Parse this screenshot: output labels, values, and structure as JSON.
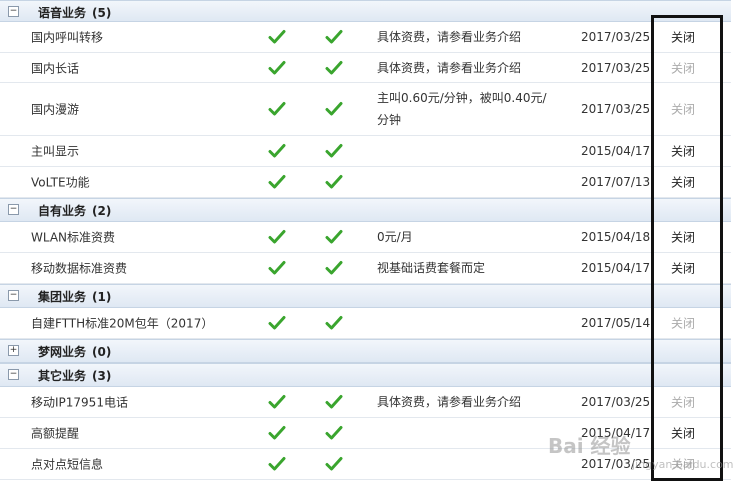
{
  "groups": [
    {
      "title": "语音业务",
      "count": "(5)",
      "toggle": "−",
      "rows": [
        {
          "name": "国内呼叫转移",
          "desc": "具体资费，请参看业务介绍",
          "date": "2017/03/25",
          "action": "关闭",
          "action_enabled": true
        },
        {
          "name": "国内长话",
          "desc": "具体资费，请参看业务介绍",
          "date": "2017/03/25",
          "action": "关闭",
          "action_enabled": false
        },
        {
          "name": "国内漫游",
          "desc_line1": "主叫0.60元/分钟，被叫0.40元/",
          "desc_line2": "分钟",
          "date": "2017/03/25",
          "action": "关闭",
          "action_enabled": false
        },
        {
          "name": "主叫显示",
          "desc": "",
          "date": "2015/04/17",
          "action": "关闭",
          "action_enabled": true
        },
        {
          "name": "VoLTE功能",
          "desc": "",
          "date": "2017/07/13",
          "action": "关闭",
          "action_enabled": true
        }
      ]
    },
    {
      "title": "自有业务",
      "count": "(2)",
      "toggle": "−",
      "rows": [
        {
          "name": "WLAN标准资费",
          "desc": "0元/月",
          "date": "2015/04/18",
          "action": "关闭",
          "action_enabled": true
        },
        {
          "name": "移动数据标准资费",
          "desc": "视基础话费套餐而定",
          "date": "2015/04/17",
          "action": "关闭",
          "action_enabled": true
        }
      ]
    },
    {
      "title": "集团业务",
      "count": "(1)",
      "toggle": "−",
      "rows": [
        {
          "name": "自建FTTH标准20M包年（2017）",
          "desc": "",
          "date": "2017/05/14",
          "action": "关闭",
          "action_enabled": false
        }
      ]
    },
    {
      "title": "梦网业务",
      "count": "(0)",
      "toggle": "+",
      "rows": []
    },
    {
      "title": "其它业务",
      "count": "(3)",
      "toggle": "−",
      "rows": [
        {
          "name": "移动IP17951电话",
          "desc": "具体资费，请参看业务介绍",
          "date": "2017/03/25",
          "action": "关闭",
          "action_enabled": false
        },
        {
          "name": "高额提醒",
          "desc": "",
          "date": "2015/04/17",
          "action": "关闭",
          "action_enabled": true
        },
        {
          "name": "点对点短信息",
          "desc": "",
          "date": "2017/03/25",
          "action": "关闭",
          "action_enabled": false
        }
      ]
    }
  ],
  "colors": {
    "check": "#3aa52e",
    "accent_frame": "#111111",
    "group_bg": "#e6eef7"
  },
  "icons": {
    "check": "check-icon",
    "toggle": "collapse-toggle-icon"
  },
  "watermark": {
    "brand": "Bai 经验",
    "url": "jingyan.baidu.com"
  }
}
